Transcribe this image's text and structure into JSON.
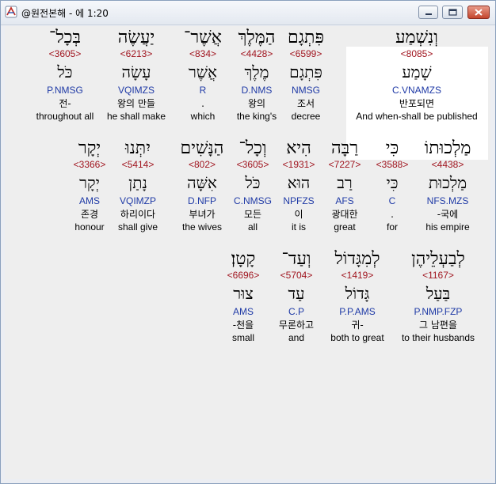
{
  "window": {
    "title": "@원전본해 - 에 1:20",
    "minimize_icon": "minimize-icon",
    "maximize_icon": "maximize-icon",
    "close_icon": "close-icon",
    "app_icon": "app-icon",
    "colors": {
      "strong": "#a0151f",
      "morph": "#1f3aa6",
      "background": "#eeeeee",
      "selected": "#ffffff"
    }
  },
  "rows": [
    {
      "words": [
        {
          "hebrew": "וְנִשְׁמַע",
          "strong": "<8085>",
          "lexeme": "שָׁמַע",
          "morph": "C.VNAMZS",
          "korean": "반포되면",
          "english": "And when-shall be published"
        },
        {
          "hebrew": "פִּתְגָם",
          "strong": "<6599>",
          "lexeme": "פִּתְגָם",
          "morph": "NMSG",
          "korean": "조서",
          "english": "decree"
        },
        {
          "hebrew": "הַמֶּלֶךְ",
          "strong": "<4428>",
          "lexeme": "מֶלֶךְ",
          "morph": "D.NMS",
          "korean": "왕의",
          "english": "the king's"
        },
        {
          "hebrew": "אֲשֶׁר־",
          "strong": "<834>",
          "lexeme": "אֲשֶׁר",
          "morph": "R",
          "korean": ".",
          "english": "which"
        },
        {
          "hebrew": "יַעֲשֶׂה",
          "strong": "<6213>",
          "lexeme": "עָשָׂה",
          "morph": "VQIMZS",
          "korean": "왕의 만들",
          "english": "he shall make"
        },
        {
          "hebrew": "בְּכָל־",
          "strong": "<3605>",
          "lexeme": "כֹּל",
          "morph": "P.NMSG",
          "korean": "전-",
          "english": "throughout all"
        }
      ]
    },
    {
      "words": [
        {
          "hebrew": "מַלְכוּתוֹ",
          "strong": "<4438>",
          "lexeme": "מַלְכוּת",
          "morph": "NFS.MZS",
          "korean": "-국에",
          "english": "his empire"
        },
        {
          "hebrew": "כִּי",
          "strong": "<3588>",
          "lexeme": "כִּי",
          "morph": "C",
          "korean": ".",
          "english": "for"
        },
        {
          "hebrew": "רַבָּה",
          "strong": "<7227>",
          "lexeme": "רַב",
          "morph": "AFS",
          "korean": "광대한",
          "english": "great"
        },
        {
          "hebrew": "הִיא",
          "strong": "<1931>",
          "lexeme": "הוּא",
          "morph": "NPFZS",
          "korean": "이",
          "english": "it is"
        },
        {
          "hebrew": "וְכָל־",
          "strong": "<3605>",
          "lexeme": "כֹּל",
          "morph": "C.NMSG",
          "korean": "모든",
          "english": "all"
        },
        {
          "hebrew": "הַנָּשִׁים",
          "strong": "<802>",
          "lexeme": "אִשָּׁה",
          "morph": "D.NFP",
          "korean": "부녀가",
          "english": "the wives"
        },
        {
          "hebrew": "יִתְּנוּ",
          "strong": "<5414>",
          "lexeme": "נָתַן",
          "morph": "VQIMZP",
          "korean": "하리이다",
          "english": "shall give"
        },
        {
          "hebrew": "יְקָר",
          "strong": "<3366>",
          "lexeme": "יְקָר",
          "morph": "AMS",
          "korean": "존경",
          "english": "honour"
        }
      ]
    },
    {
      "words": [
        {
          "hebrew": "לְבַעְלֵיהֶן",
          "strong": "<1167>",
          "lexeme": "בַּעַל",
          "morph": "P.NMP.FZP",
          "korean": "그 남편을",
          "english": "to their husbands"
        },
        {
          "hebrew": "לְמִגָּדוֹל",
          "strong": "<1419>",
          "lexeme": "גָּדוֹל",
          "morph": "P.P.AMS",
          "korean": "귀-",
          "english": "both to great"
        },
        {
          "hebrew": "וְעַד־",
          "strong": "<5704>",
          "lexeme": "עַד",
          "morph": "C.P",
          "korean": "무론하고",
          "english": "and"
        },
        {
          "hebrew": "קָטָן׃",
          "strong": "<6696>",
          "lexeme": "צוּר",
          "morph": "AMS",
          "korean": "-천을",
          "english": "small"
        }
      ]
    }
  ]
}
